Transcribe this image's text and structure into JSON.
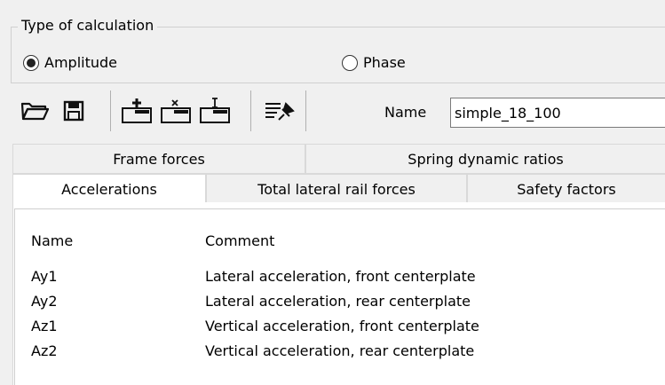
{
  "calc_type": {
    "title": "Type of calculation",
    "options": [
      {
        "label": "Amplitude",
        "selected": true
      },
      {
        "label": "Phase",
        "selected": false
      }
    ]
  },
  "toolbar": {
    "buttons": [
      "open-folder-icon",
      "save-icon",
      "add-row-icon",
      "delete-row-icon",
      "insert-row-icon",
      "pin-list-icon"
    ],
    "name_label": "Name",
    "name_value": "simple_18_100"
  },
  "tabs": {
    "row1": [
      "Frame forces",
      "Spring dynamic ratios"
    ],
    "row2": [
      "Accelerations",
      "Total lateral rail forces",
      "Safety factors"
    ],
    "active": "Accelerations"
  },
  "list": {
    "columns": [
      "Name",
      "Comment"
    ],
    "rows": [
      {
        "name": "Ay1",
        "comment": "Lateral acceleration, front centerplate"
      },
      {
        "name": "Ay2",
        "comment": "Lateral acceleration, rear centerplate"
      },
      {
        "name": "Az1",
        "comment": "Vertical acceleration, front centerplate"
      },
      {
        "name": "Az2",
        "comment": "Vertical acceleration, rear centerplate"
      }
    ]
  }
}
